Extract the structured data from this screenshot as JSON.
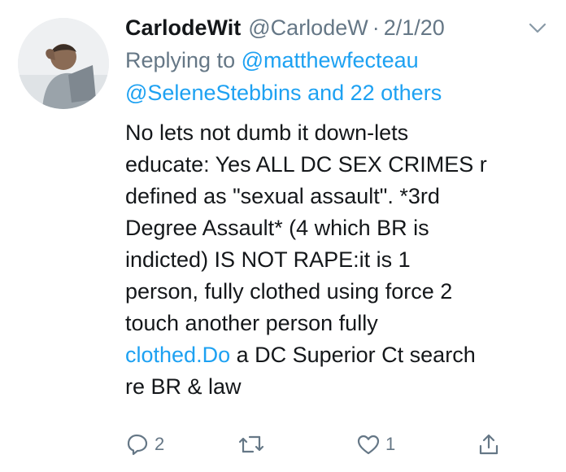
{
  "author": {
    "display_name": "CarlodeWit",
    "handle": "@CarlodeW",
    "separator": "·",
    "date": "2/1/20"
  },
  "reply_context": {
    "prefix": "Replying to ",
    "first_mention": "@matthewfecteau",
    "second_line_mention": "@SeleneStebbins",
    "and_others": " and 22 others"
  },
  "body": {
    "lines": [
      "No lets not dumb it down-lets",
      "educate: Yes ALL DC SEX CRIMES r",
      "defined as \"sexual assault\". *3rd",
      "Degree Assault* (4 which BR is",
      "indicted) IS NOT RAPE:it is 1",
      "person, fully clothed using force 2",
      "touch another person fully"
    ],
    "last_line_link": "clothed.Do",
    "last_line_rest": " a DC Superior Ct search",
    "final_line": "re BR & law"
  },
  "actions": {
    "reply_icon": "reply-icon",
    "reply_count": "2",
    "retweet_icon": "retweet-icon",
    "like_icon": "heart-icon",
    "like_count": "1",
    "share_icon": "share-icon"
  },
  "colors": {
    "link": "#1da1f2",
    "muted": "#657786",
    "text": "#14171a"
  }
}
